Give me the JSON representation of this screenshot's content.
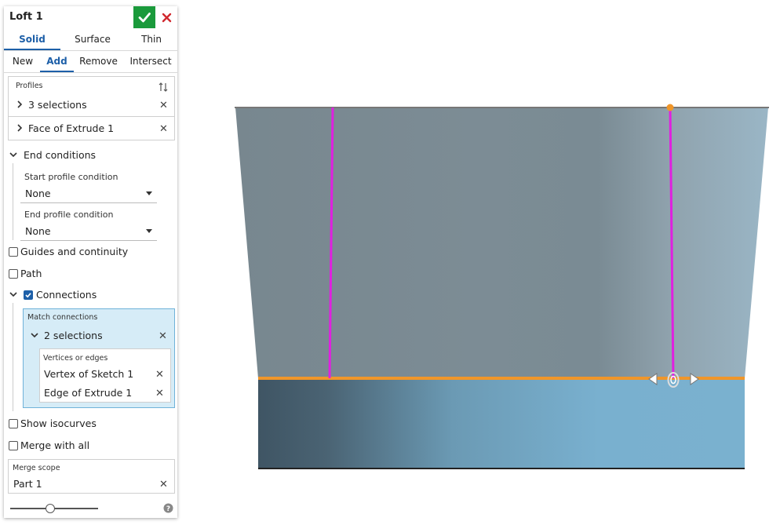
{
  "dialog": {
    "title": "Loft 1",
    "confirm_icon": "checkmark-icon",
    "cancel_icon": "close-icon",
    "colors": {
      "accent": "#1d5fa8",
      "confirm": "#1a9a3b",
      "cancel": "#d0282e"
    }
  },
  "creation_tabs": [
    {
      "label": "Solid",
      "active": true
    },
    {
      "label": "Surface",
      "active": false
    },
    {
      "label": "Thin",
      "active": false
    }
  ],
  "operation_tabs": [
    {
      "label": "New",
      "active": false
    },
    {
      "label": "Add",
      "active": true
    },
    {
      "label": "Remove",
      "active": false
    },
    {
      "label": "Intersect",
      "active": false
    }
  ],
  "profiles": {
    "label": "Profiles",
    "items": [
      {
        "label": "3 selections"
      },
      {
        "label": "Face of Extrude 1"
      }
    ]
  },
  "end_conditions": {
    "label": "End conditions",
    "start_label": "Start profile condition",
    "start_value": "None",
    "end_label": "End profile condition",
    "end_value": "None"
  },
  "options": {
    "guides": {
      "label": "Guides and continuity",
      "checked": false
    },
    "path": {
      "label": "Path",
      "checked": false
    },
    "connections": {
      "label": "Connections",
      "checked": true
    }
  },
  "match_connections": {
    "label": "Match connections",
    "selection_label": "2 selections",
    "sub_label": "Vertices or edges",
    "items": [
      {
        "label": "Vertex of Sketch 1"
      },
      {
        "label": "Edge of Extrude 1"
      }
    ]
  },
  "show_isocurves": {
    "label": "Show isocurves",
    "checked": false
  },
  "merge_with_all": {
    "label": "Merge with all",
    "checked": false
  },
  "merge_scope": {
    "label": "Merge scope",
    "value": "Part 1"
  },
  "footer": {
    "slider_value": 0.45,
    "help_icon": "help-icon"
  },
  "viewport": {
    "colors": {
      "top_face": "#7a8c95",
      "bottom_face": "#6a9cb8",
      "connection_line": "#e020e0",
      "edge_highlight": "#f0962a"
    }
  }
}
